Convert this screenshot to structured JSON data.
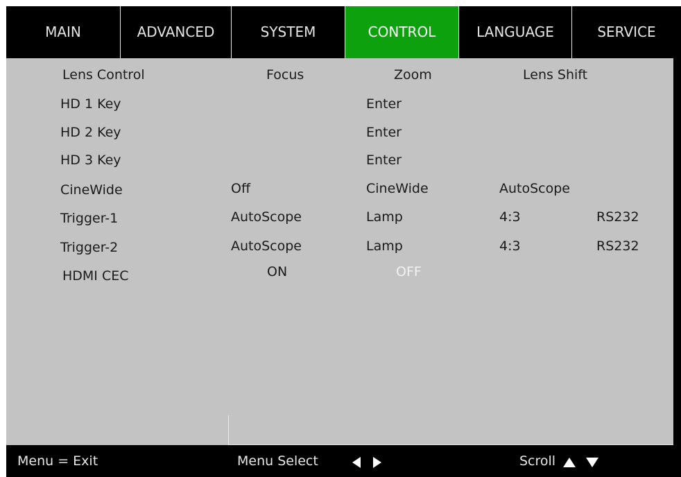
{
  "tabs": {
    "main": "MAIN",
    "advanced": "ADVANCED",
    "system": "SYSTEM",
    "control": "CONTROL",
    "language": "LANGUAGE",
    "service": "SERVICE",
    "active": "CONTROL"
  },
  "rows": {
    "lens_control": {
      "label": "Lens Control",
      "opt1": "Focus",
      "opt2": "Zoom",
      "opt3": "Lens Shift"
    },
    "hd1": {
      "label": "HD 1 Key",
      "value": "Enter"
    },
    "hd2": {
      "label": "HD 2 Key",
      "value": "Enter"
    },
    "hd3": {
      "label": "HD 3 Key",
      "value": "Enter"
    },
    "cinewide": {
      "label": "CineWide",
      "opt1": "Off",
      "opt2": "CineWide",
      "opt3": "AutoScope"
    },
    "trigger1": {
      "label": "Trigger-1",
      "opt1": "AutoScope",
      "opt2": "Lamp",
      "opt3": "4:3",
      "opt4": "RS232"
    },
    "trigger2": {
      "label": "Trigger-2",
      "opt1": "AutoScope",
      "opt2": "Lamp",
      "opt3": "4:3",
      "opt4": "RS232"
    },
    "hdmi_cec": {
      "label": "HDMI CEC",
      "opt1": "ON",
      "opt2": "OFF",
      "selected": "OFF"
    }
  },
  "status": {
    "exit": "Menu = Exit",
    "select": "Menu Select",
    "scroll": "Scroll"
  },
  "colors": {
    "active_tab": "#0da10d",
    "panel": "#c3c3c3",
    "bar": "#000000",
    "selected_text": "#f2f2f2"
  }
}
